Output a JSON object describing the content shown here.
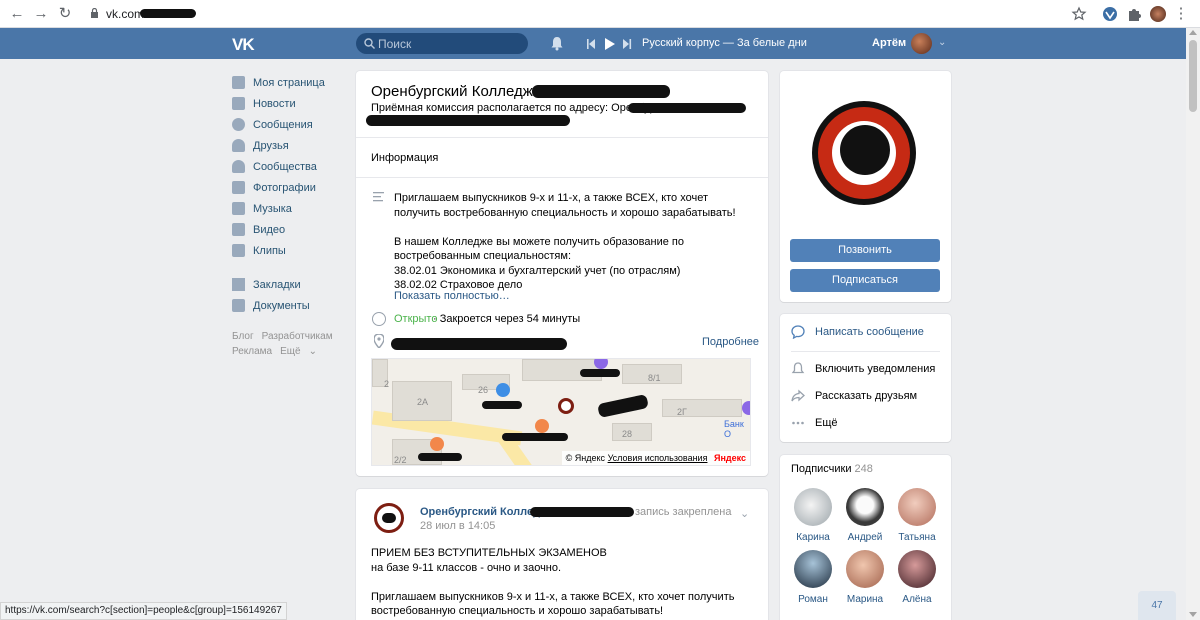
{
  "browser": {
    "url": "vk.com/c"
  },
  "header": {
    "logo": "VK",
    "search_placeholder": "Поиск",
    "track": "Русский корпус — За белые дни",
    "user_name": "Артём"
  },
  "left_menu": {
    "items": [
      {
        "label": "Моя страница"
      },
      {
        "label": "Новости"
      },
      {
        "label": "Сообщения"
      },
      {
        "label": "Друзья"
      },
      {
        "label": "Сообщества"
      },
      {
        "label": "Фотографии"
      },
      {
        "label": "Музыка"
      },
      {
        "label": "Видео"
      },
      {
        "label": "Клипы"
      }
    ],
    "extra": [
      {
        "label": "Закладки"
      },
      {
        "label": "Документы"
      }
    ],
    "footer": {
      "blog": "Блог",
      "dev": "Разработчикам",
      "ads": "Реклама",
      "more": "Ещё"
    }
  },
  "group": {
    "title": "Оренбургский Колледж",
    "address_line": "Приёмная комиссия располагается по адресу: Оренбург,",
    "tab": "Информация",
    "description": [
      "Приглашаем выпускников 9-х и 11-х, а также ВСЕХ, кто хочет получить востребованную специальность и хорошо зарабатывать!",
      "В нашем Колледже вы можете получить образование по востребованным специальностям:\n38.02.01 Экономика и бухгалтерский учет (по отраслям)\n38.02.02 Страховое дело"
    ],
    "show_more": "Показать полностью…",
    "open_status": "Открыто",
    "closes_in": " · Закроется через 54 минуты",
    "details_link": "Подробнее",
    "map": {
      "copyright_prefix": "© Яндекс",
      "terms": "Условия использования",
      "brand": "Яндекс",
      "labels": [
        "2",
        "2A",
        "26",
        "8/1",
        "2Г",
        "28",
        "2/2",
        "Банк О"
      ]
    }
  },
  "post": {
    "author": "Оренбургский Колледж",
    "pinned": "запись закреплена",
    "date": "28 июл в 14:05",
    "paragraphs": [
      "ПРИЕМ БЕЗ ВСТУПИТЕЛЬНЫХ ЭКЗАМЕНОВ\nна базе 9-11 классов - очно и заочно.",
      "Приглашаем выпускников 9-х и 11-х, а также ВСЕХ, кто хочет получить востребованную специальность и хорошо зарабатывать!"
    ]
  },
  "side": {
    "call_btn": "Позвонить",
    "subscribe_btn": "Подписаться",
    "actions": [
      {
        "label": "Написать сообщение"
      },
      {
        "label": "Включить уведомления"
      },
      {
        "label": "Рассказать друзьям"
      },
      {
        "label": "Ещё"
      }
    ],
    "subscribers_label": "Подписчики",
    "subscribers_count": "248",
    "subscribers": [
      {
        "name": "Карина"
      },
      {
        "name": "Андрей"
      },
      {
        "name": "Татьяна"
      },
      {
        "name": "Роман"
      },
      {
        "name": "Марина"
      },
      {
        "name": "Алёна"
      }
    ]
  },
  "statusbar": "https://vk.com/search?c[section]=people&c[group]=156149267",
  "chat_count": "47",
  "colors": {
    "vk_blue": "#4a76a8",
    "button": "#5181b8",
    "link": "#2a5885",
    "open_green": "#4bb34b"
  }
}
